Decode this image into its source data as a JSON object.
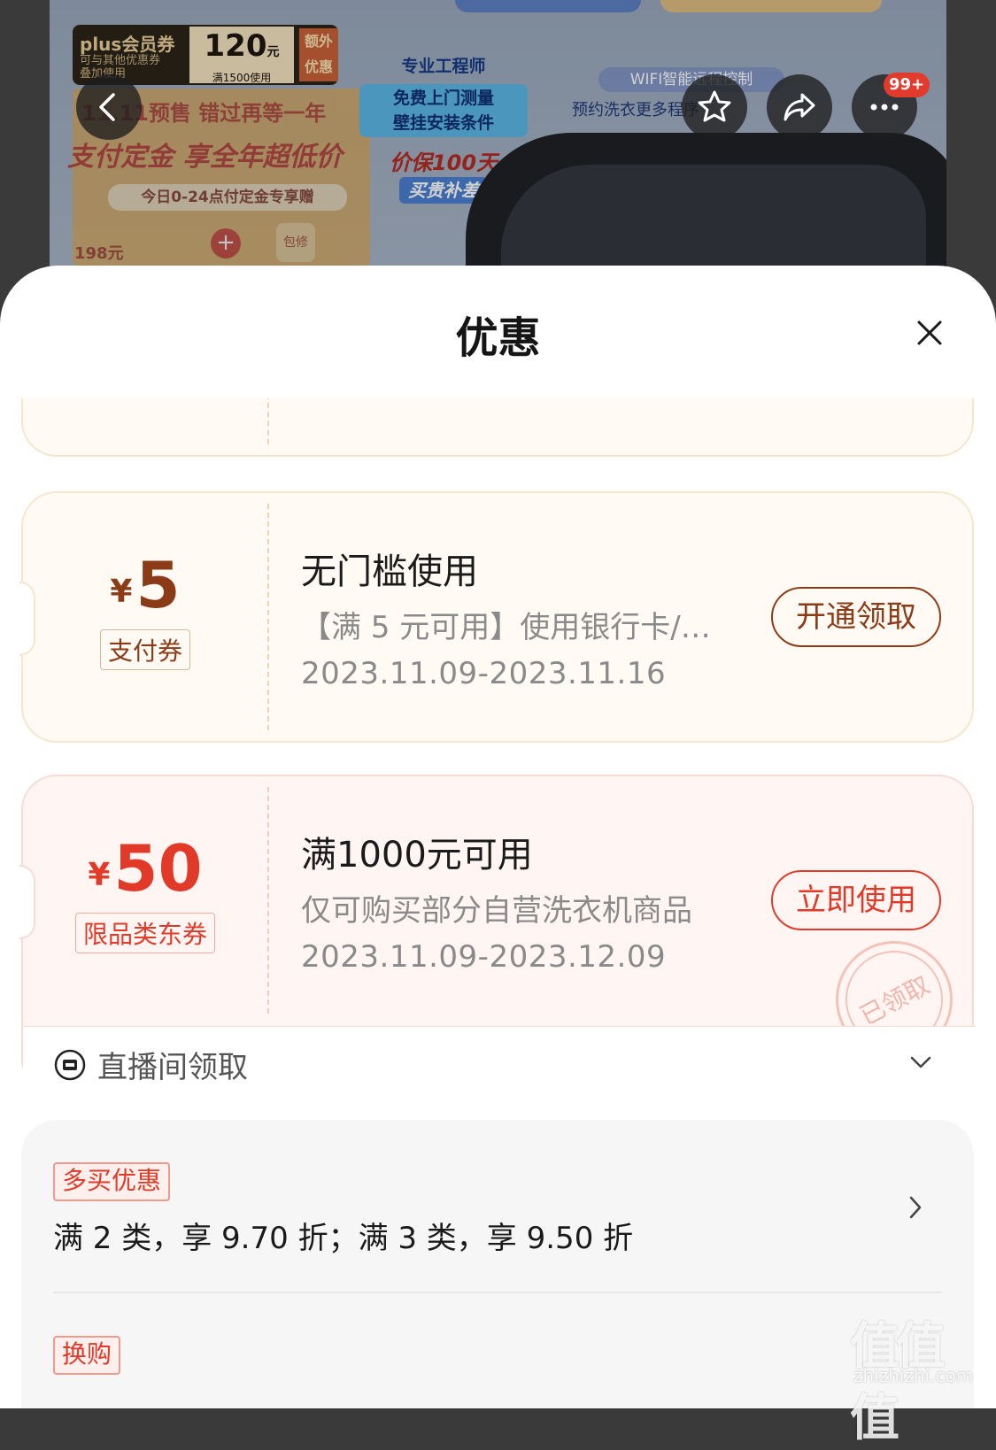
{
  "banner": {
    "plus_coupon": {
      "title": "plus会员券",
      "desc_line1": "可与其他优惠券",
      "desc_line2": "叠加使用",
      "amount": "120",
      "unit": "元",
      "condition": "满1500使用",
      "extra_line1": "额外",
      "extra_line2": "优惠"
    },
    "presale_line1": "11.11预售 错过再等一年",
    "presale_line2": "支付定金 享全年超低价",
    "presale_line3": "今日0-24点付定金专享赠",
    "presale_price": "198元",
    "presale_badge": "包修",
    "engineer_title": "专业工程师",
    "engineer_line1": "免费上门测量",
    "engineer_line2": "壁挂安装条件",
    "price_protect_line1": "价保100天",
    "price_protect_line2": "买贵补差",
    "wifi_label": "WIFI智能远程控制",
    "wifi_sub": "预约洗衣更多程序"
  },
  "nav": {
    "back_icon": "chevron-left-icon",
    "favorite_icon": "star-icon",
    "share_icon": "share-icon",
    "more_icon": "more-dots-icon",
    "more_badge": "99+"
  },
  "sheet": {
    "title": "优惠",
    "close_icon": "close-icon"
  },
  "coupons": [
    {
      "currency": "¥",
      "amount": "5",
      "type_label": "支付券",
      "title": "无门槛使用",
      "desc": "【满 5 元可用】使用银行卡/…",
      "date_range": "2023.11.09-2023.11.16",
      "button_label": "开通领取",
      "accent": "#8b3b16"
    },
    {
      "currency": "¥",
      "amount": "50",
      "type_label": "限品类东券",
      "title": "满1000元可用",
      "desc": "仅可购买部分自营洗衣机商品",
      "date_range": "2023.11.09-2023.12.09",
      "button_label": "立即使用",
      "stamp": "已领取",
      "source_label": "直播间领取",
      "accent": "#e23a28"
    }
  ],
  "promotions": [
    {
      "tag": "多买优惠",
      "text": "满 2 类，享 9.70 折；满 3 类，享 9.50 折"
    },
    {
      "tag": "换购"
    }
  ],
  "watermark": {
    "logo": "值值值",
    "site": "zhizhizhi.com"
  }
}
